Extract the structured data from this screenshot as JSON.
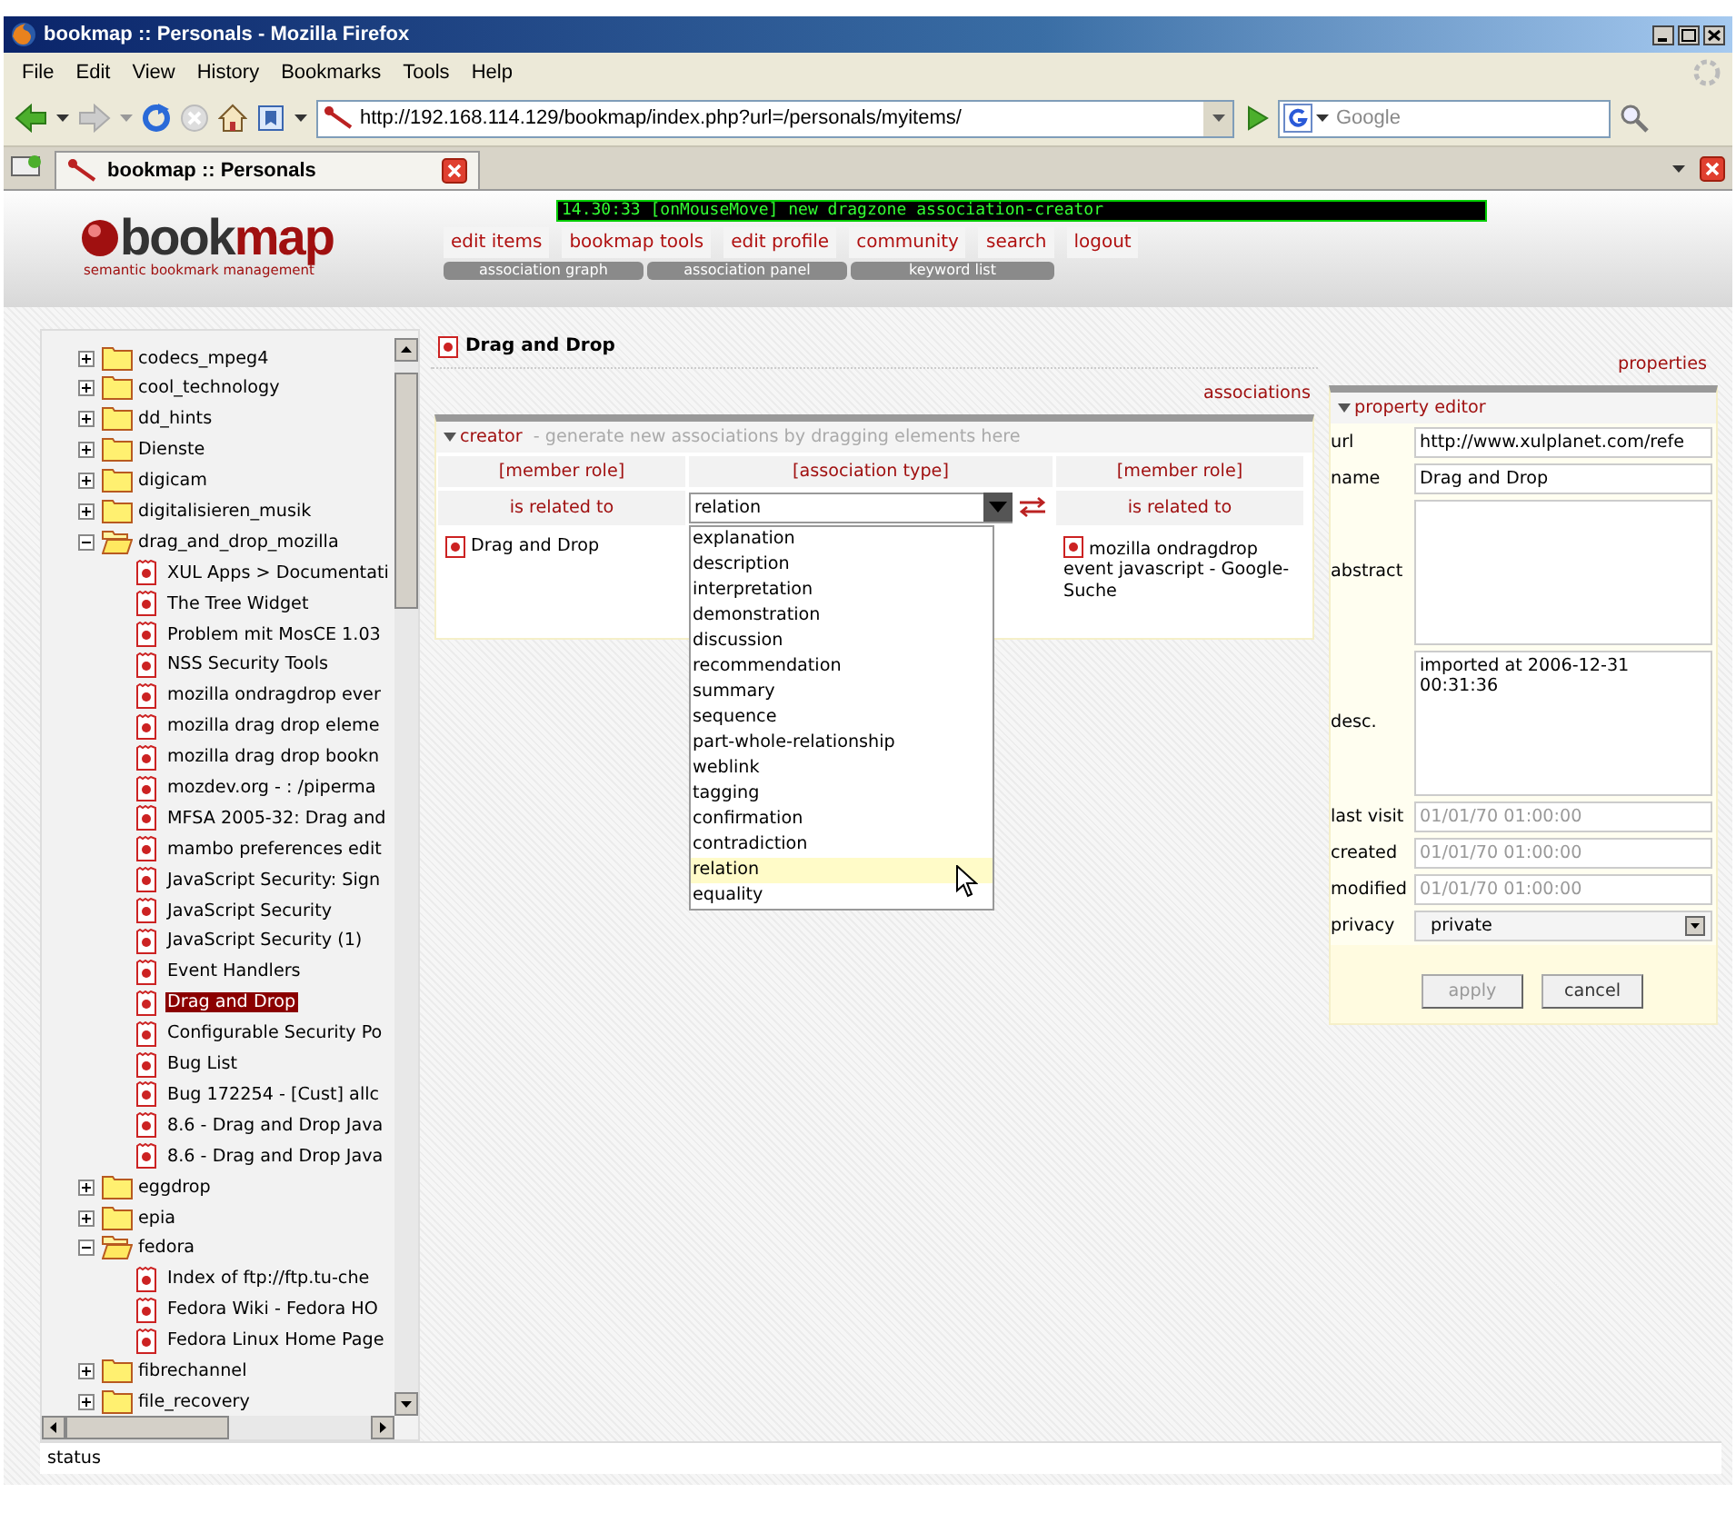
{
  "window": {
    "title": "bookmap :: Personals - Mozilla Firefox"
  },
  "menu": [
    "File",
    "Edit",
    "View",
    "History",
    "Bookmarks",
    "Tools",
    "Help"
  ],
  "address_bar": {
    "url": "http://192.168.114.129/bookmap/index.php?url=/personals/myitems/"
  },
  "search": {
    "placeholder": "Google"
  },
  "tabs": [
    {
      "label": "bookmap :: Personals",
      "selected": true
    }
  ],
  "header": {
    "logo_first": "book",
    "logo_second": "map",
    "tagline": "semantic bookmark management",
    "console": "14.30:33 [onMouseMove] new dragzone association-creator",
    "nav": [
      "edit items",
      "bookmap tools",
      "edit profile",
      "community",
      "search",
      "logout"
    ],
    "subnav": [
      "association graph",
      "association panel",
      "keyword list"
    ]
  },
  "tree": [
    {
      "label": "codecs_mpeg4",
      "kind": "folder",
      "expanded": false,
      "selected": false
    },
    {
      "label": "cool_technology",
      "kind": "folder",
      "expanded": false,
      "selected": false
    },
    {
      "label": "dd_hints",
      "kind": "folder",
      "expanded": false,
      "selected": false
    },
    {
      "label": "Dienste",
      "kind": "folder",
      "expanded": false,
      "selected": false
    },
    {
      "label": "digicam",
      "kind": "folder",
      "expanded": false,
      "selected": false
    },
    {
      "label": "digitalisieren_musik",
      "kind": "folder",
      "expanded": false,
      "selected": false
    },
    {
      "label": "drag_and_drop_mozilla",
      "kind": "folder",
      "expanded": true,
      "selected": false,
      "children": [
        {
          "label": "XUL Apps > Documentati",
          "kind": "bookmark",
          "selected": false
        },
        {
          "label": "The Tree Widget",
          "kind": "bookmark",
          "selected": false
        },
        {
          "label": "Problem mit MosCE 1.03",
          "kind": "bookmark",
          "selected": false
        },
        {
          "label": "NSS Security Tools",
          "kind": "bookmark",
          "selected": false
        },
        {
          "label": "mozilla ondragdrop ever",
          "kind": "bookmark",
          "selected": false
        },
        {
          "label": "mozilla drag drop eleme",
          "kind": "bookmark",
          "selected": false
        },
        {
          "label": "mozilla drag drop bookn",
          "kind": "bookmark",
          "selected": false
        },
        {
          "label": "mozdev.org - : /piperma",
          "kind": "bookmark",
          "selected": false
        },
        {
          "label": "MFSA 2005-32: Drag and",
          "kind": "bookmark",
          "selected": false
        },
        {
          "label": "mambo preferences edit",
          "kind": "bookmark",
          "selected": false
        },
        {
          "label": "JavaScript Security: Sign",
          "kind": "bookmark",
          "selected": false
        },
        {
          "label": "JavaScript Security",
          "kind": "bookmark",
          "selected": false
        },
        {
          "label": "JavaScript Security (1)",
          "kind": "bookmark",
          "selected": false
        },
        {
          "label": "Event Handlers",
          "kind": "bookmark",
          "selected": false
        },
        {
          "label": "Drag and Drop",
          "kind": "bookmark",
          "selected": true
        },
        {
          "label": "Configurable Security Po",
          "kind": "bookmark",
          "selected": false
        },
        {
          "label": "Bug List",
          "kind": "bookmark",
          "selected": false
        },
        {
          "label": "Bug 172254 - [Cust] allc",
          "kind": "bookmark",
          "selected": false
        },
        {
          "label": "8.6 - Drag and Drop Java",
          "kind": "bookmark",
          "selected": false
        },
        {
          "label": "8.6 - Drag and Drop Java",
          "kind": "bookmark",
          "selected": false
        }
      ]
    },
    {
      "label": "eggdrop",
      "kind": "folder",
      "expanded": false,
      "selected": false
    },
    {
      "label": "epia",
      "kind": "folder",
      "expanded": false,
      "selected": false
    },
    {
      "label": "fedora",
      "kind": "folder",
      "expanded": true,
      "selected": false,
      "children": [
        {
          "label": "Index of ftp://ftp.tu-che",
          "kind": "bookmark",
          "selected": false
        },
        {
          "label": "Fedora Wiki - Fedora HO",
          "kind": "bookmark",
          "selected": false
        },
        {
          "label": "Fedora Linux Home Page",
          "kind": "bookmark",
          "selected": false
        }
      ]
    },
    {
      "label": "fibrechannel",
      "kind": "folder",
      "expanded": false,
      "selected": false
    },
    {
      "label": "file_recovery",
      "kind": "folder",
      "expanded": false,
      "selected": false
    }
  ],
  "detail": {
    "title": "Drag and Drop",
    "link": "associations",
    "creator": {
      "title": "creator",
      "hint": "- generate new associations by dragging elements here",
      "headers": [
        "[member role]",
        "[association type]",
        "[member role]"
      ],
      "left_role": "is related to",
      "type_value": "relation",
      "right_role": "is related to",
      "left_item": "Drag and Drop",
      "right_item": "mozilla ondragdrop event javascript - Google-Suche",
      "options": [
        {
          "label": "explanation",
          "selected": false
        },
        {
          "label": "description",
          "selected": false
        },
        {
          "label": "interpretation",
          "selected": false
        },
        {
          "label": "demonstration",
          "selected": false
        },
        {
          "label": "discussion",
          "selected": false
        },
        {
          "label": "recommendation",
          "selected": false
        },
        {
          "label": "summary",
          "selected": false
        },
        {
          "label": "sequence",
          "selected": false
        },
        {
          "label": "part-whole-relationship",
          "selected": false
        },
        {
          "label": "weblink",
          "selected": false
        },
        {
          "label": "tagging",
          "selected": false
        },
        {
          "label": "confirmation",
          "selected": false
        },
        {
          "label": "contradiction",
          "selected": false
        },
        {
          "label": "relation",
          "selected": true
        },
        {
          "label": "equality",
          "selected": false
        }
      ]
    }
  },
  "properties": {
    "link": "properties",
    "title": "property editor",
    "fields": [
      {
        "label": "url",
        "kind": "input",
        "value": "http://www.xulplanet.com/refe"
      },
      {
        "label": "name",
        "kind": "input",
        "value": "Drag and Drop"
      },
      {
        "label": "abstract",
        "kind": "textarea"
      },
      {
        "label": "desc.",
        "kind": "textarea",
        "value": "imported at 2006-12-31 00:31:36"
      },
      {
        "label": "last visit",
        "kind": "readonly",
        "value": "01/01/70 01:00:00"
      },
      {
        "label": "created",
        "kind": "readonly",
        "value": "01/01/70 01:00:00"
      },
      {
        "label": "modified",
        "kind": "readonly",
        "value": "01/01/70 01:00:00"
      },
      {
        "label": "privacy",
        "kind": "select",
        "value": "private"
      }
    ],
    "buttons": [
      {
        "label": "apply",
        "disabled": true
      },
      {
        "label": "cancel",
        "disabled": false
      }
    ]
  },
  "status_bar": "status"
}
